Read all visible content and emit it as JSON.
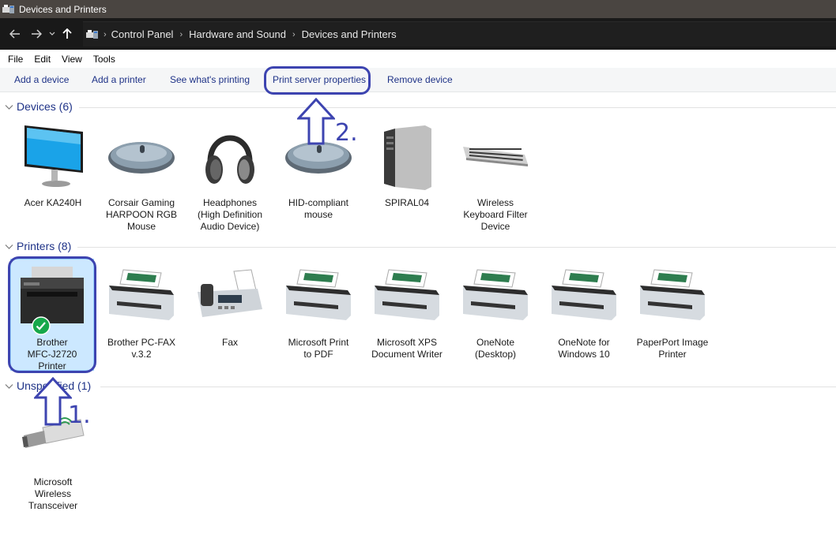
{
  "window": {
    "title": "Devices and Printers"
  },
  "address": {
    "breadcrumbs": [
      "Control Panel",
      "Hardware and Sound",
      "Devices and Printers"
    ]
  },
  "menu": [
    "File",
    "Edit",
    "View",
    "Tools"
  ],
  "toolbar": {
    "add_device": "Add a device",
    "add_printer": "Add a printer",
    "see_printing": "See what's printing",
    "print_server": "Print server properties",
    "remove_device": "Remove device"
  },
  "groups": {
    "devices": {
      "title": "Devices (6)",
      "items": [
        {
          "label": "Acer KA240H",
          "icon": "monitor-icon"
        },
        {
          "label": "Corsair Gaming\nHARPOON RGB\nMouse",
          "icon": "mouse-icon"
        },
        {
          "label": "Headphones\n(High Definition\nAudio Device)",
          "icon": "headphones-icon"
        },
        {
          "label": "HID-compliant\nmouse",
          "icon": "mouse-icon"
        },
        {
          "label": "SPIRAL04",
          "icon": "computer-tower-icon"
        },
        {
          "label": "Wireless\nKeyboard Filter\nDevice",
          "icon": "keyboard-icon"
        }
      ]
    },
    "printers": {
      "title": "Printers (8)",
      "items": [
        {
          "label": "Brother\nMFC-J2720\nPrinter",
          "icon": "multifunction-printer-icon",
          "default": true,
          "selected": true
        },
        {
          "label": "Brother PC-FAX\nv.3.2",
          "icon": "printer-icon"
        },
        {
          "label": "Fax",
          "icon": "fax-icon"
        },
        {
          "label": "Microsoft Print\nto PDF",
          "icon": "printer-icon"
        },
        {
          "label": "Microsoft XPS\nDocument Writer",
          "icon": "printer-icon"
        },
        {
          "label": "OneNote\n(Desktop)",
          "icon": "printer-icon"
        },
        {
          "label": "OneNote for\nWindows 10",
          "icon": "printer-icon"
        },
        {
          "label": "PaperPort Image\nPrinter",
          "icon": "printer-icon"
        }
      ]
    },
    "unspecified": {
      "title": "Unspecified (1)",
      "items": [
        {
          "label": "Microsoft\nWireless\nTransceiver",
          "icon": "usb-transceiver-icon"
        }
      ]
    }
  },
  "annotations": {
    "step1": "1.",
    "step2": "2.",
    "color": "#3d44b0"
  },
  "colors": {
    "link_blue": "#1e3287",
    "selection": "#cce8ff",
    "titlebar": "#4a4541",
    "addressbar": "#191919"
  }
}
